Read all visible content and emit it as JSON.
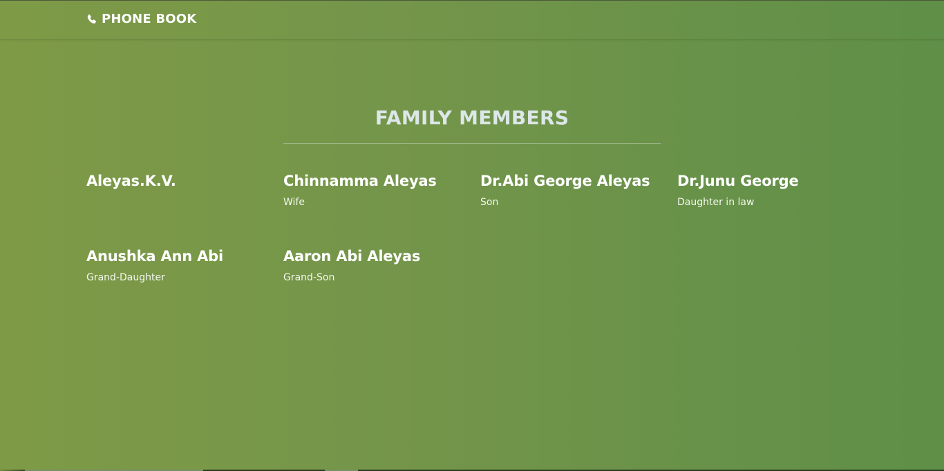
{
  "navbar": {
    "brand_label": "PHONE BOOK",
    "brand_icon": "phone-icon"
  },
  "section": {
    "title": "FAMILY MEMBERS"
  },
  "members": [
    {
      "name": "Aleyas.K.V.",
      "relation": ""
    },
    {
      "name": "Chinnamma Aleyas",
      "relation": "Wife"
    },
    {
      "name": "Dr.Abi George Aleyas",
      "relation": "Son"
    },
    {
      "name": "Dr.Junu George",
      "relation": "Daughter in law"
    },
    {
      "name": "Anushka Ann Abi",
      "relation": "Grand-Daughter"
    },
    {
      "name": "Aaron Abi Aleyas",
      "relation": "Grand-Son"
    }
  ],
  "colors": {
    "background_left": "#7e9a47",
    "background_right": "#5f8f48",
    "title": "#dde7e9",
    "text": "#ffffff"
  }
}
